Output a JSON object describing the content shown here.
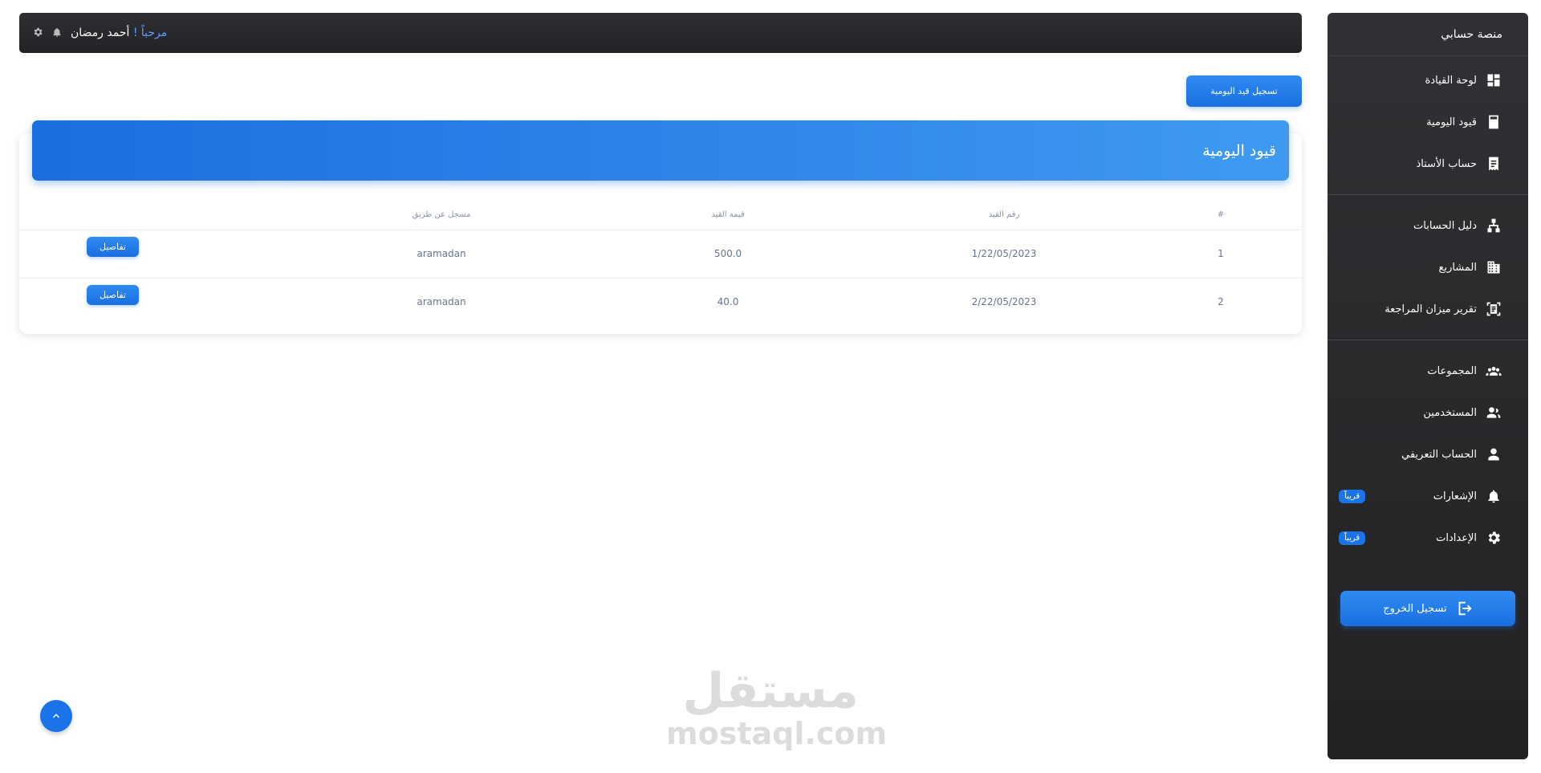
{
  "sidebar": {
    "brand": "منصة حسابي",
    "groups": [
      [
        {
          "label": "لوحة القيادة",
          "icon": "dashboard-icon"
        },
        {
          "label": "قيود اليومية",
          "icon": "calculator-icon"
        },
        {
          "label": "حساب الأستاذ",
          "icon": "receipt-icon"
        }
      ],
      [
        {
          "label": "دليل الحسابات",
          "icon": "account-tree-icon"
        },
        {
          "label": "المشاريع",
          "icon": "building-icon"
        },
        {
          "label": "تقرير ميزان المراجعة",
          "icon": "document-scanner-icon"
        }
      ],
      [
        {
          "label": "المجموعات",
          "icon": "groups-icon"
        },
        {
          "label": "المستخدمين",
          "icon": "users-icon"
        },
        {
          "label": "الحساب التعريفي",
          "icon": "person-icon"
        },
        {
          "label": "الإشعارات",
          "icon": "bell-icon",
          "badge": "قريباً"
        },
        {
          "label": "الإعدادات",
          "icon": "gear-icon",
          "badge": "قريباً"
        }
      ]
    ],
    "logout_label": "تسجيل الخروج"
  },
  "topbar": {
    "hello": "مرحباً !",
    "user_name": "أحمد رمضان"
  },
  "main": {
    "add_entry_label": "تسجيل قيد اليومية",
    "card_title": "قيود اليومية",
    "table": {
      "headers": {
        "index": "#",
        "entry_number": "رقم القيد",
        "entry_value": "قيمة القيد",
        "recorded_by": "مسجل عن طريق"
      },
      "rows": [
        {
          "index": "1",
          "entry_number": "1/22/05/2023",
          "entry_value": "500.0",
          "recorded_by": "aramadan",
          "action": "تفاصيل"
        },
        {
          "index": "2",
          "entry_number": "2/22/05/2023",
          "entry_value": "40.0",
          "recorded_by": "aramadan",
          "action": "تفاصيل"
        }
      ]
    }
  },
  "watermark": {
    "arabic": "مستقل",
    "latin": "mostaql.com"
  },
  "colors": {
    "accent": "#1a73e8",
    "sidebar_bg": "#2b2b2e",
    "topbar_bg": "#2a2a2d"
  }
}
